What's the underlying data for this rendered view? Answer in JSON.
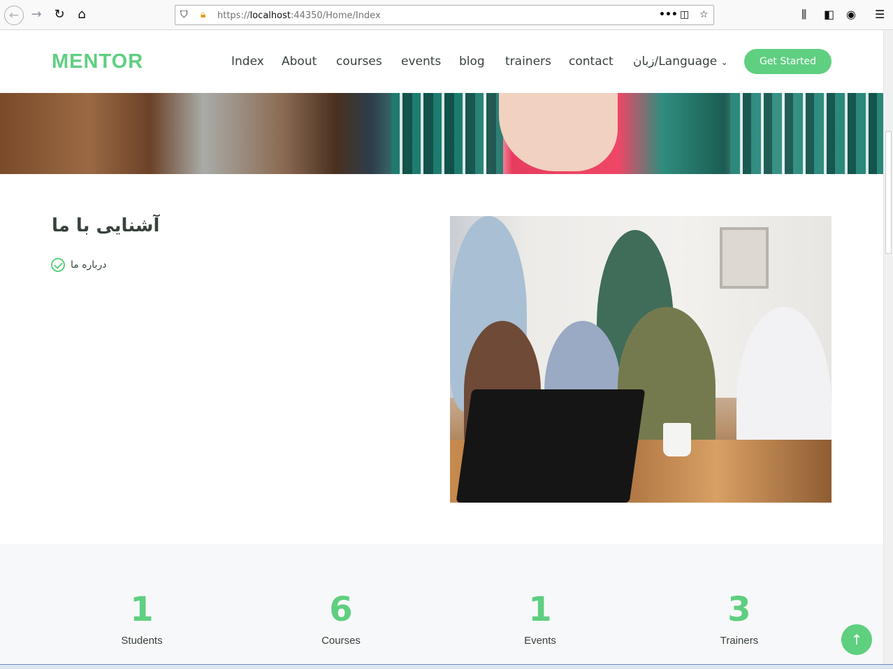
{
  "browser": {
    "url_prefix": "https://",
    "url_host": "localhost",
    "url_rest": ":44350/Home/Index",
    "icons": [
      "back-icon",
      "forward-icon",
      "reload-icon",
      "home-icon",
      "shield-icon",
      "insecure-lock-icon",
      "page-actions-icon",
      "pocket-icon",
      "bookmark-star-icon",
      "library-icon",
      "sidebar-icon",
      "account-icon",
      "menu-icon"
    ]
  },
  "header": {
    "logo": "MENTOR",
    "nav": [
      "Index",
      "About",
      "courses",
      "events",
      "blog",
      "trainers",
      "contact",
      "زبان/Language"
    ],
    "cta": "Get Started"
  },
  "about": {
    "title": "آشنایی با ما",
    "item": "درباره ما"
  },
  "stats": [
    {
      "value": "1",
      "label": "Students"
    },
    {
      "value": "6",
      "label": "Courses"
    },
    {
      "value": "1",
      "label": "Events"
    },
    {
      "value": "3",
      "label": "Trainers"
    }
  ],
  "colors": {
    "accent": "#5fcf80",
    "text": "#37423b",
    "stats_bg": "#f7f8f9"
  }
}
